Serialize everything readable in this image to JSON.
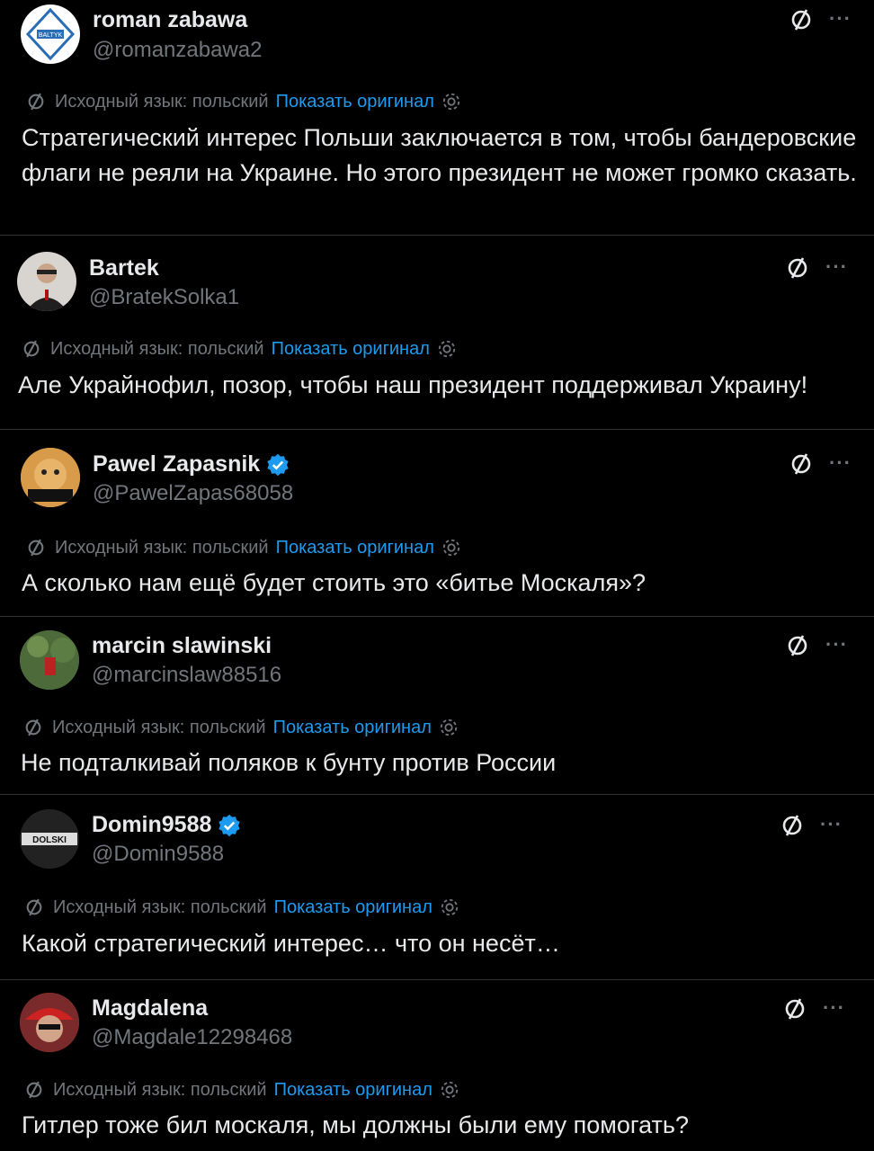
{
  "translation": {
    "source_label": "Исходный язык: польский",
    "show_original": "Показать оригинал"
  },
  "posts": [
    {
      "name": "roman zabawa",
      "handle": "@romanzabawa2",
      "verified": false,
      "avatar_label": "BALTYK",
      "text": "Стратегический интерес Польши заключается в том, чтобы бандеровские флаги не реяли на Украине. Но этого президент не может громко сказать."
    },
    {
      "name": "Bartek",
      "handle": "@BratekSolka1",
      "verified": false,
      "avatar_label": "",
      "text": "Але Украйнофил, позор, чтобы наш президент поддерживал Украину!"
    },
    {
      "name": "Pawel Zapasnik",
      "handle": "@PawelZapas68058",
      "verified": true,
      "avatar_label": "",
      "text": "А сколько нам ещё будет стоить это «битье Москаля»?"
    },
    {
      "name": "marcin slawinski",
      "handle": "@marcinslaw88516",
      "verified": false,
      "avatar_label": "",
      "text": "Не подталкивай поляков к бунту против России"
    },
    {
      "name": "Domin9588",
      "handle": "@Domin9588",
      "verified": true,
      "avatar_label": "DOLSKI",
      "text": "Какой стратегический интерес… что он несёт…"
    },
    {
      "name": "Magdalena",
      "handle": "@Magdale12298468",
      "verified": false,
      "avatar_label": "",
      "text": "Гитлер тоже бил москаля, мы должны были ему помогать?"
    }
  ],
  "colors": {
    "background": "#000000",
    "link": "#1d9bf0",
    "muted": "#71767b",
    "verified": "#1d9bf0"
  }
}
